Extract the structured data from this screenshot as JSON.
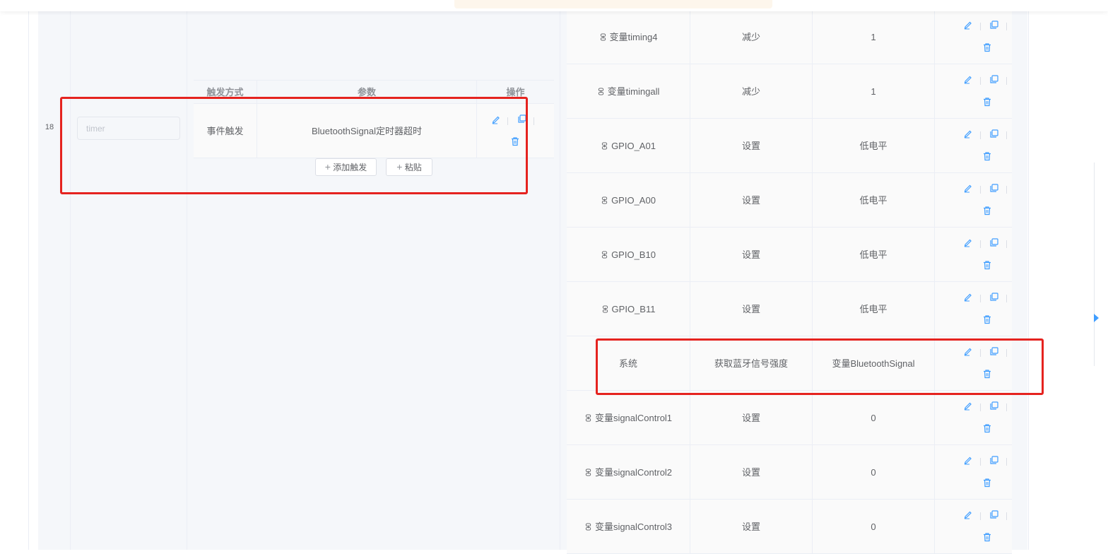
{
  "rule_row": {
    "index": "18",
    "name_placeholder": "timer"
  },
  "trigger_table": {
    "headers": [
      "触发方式",
      "参数",
      "操作"
    ],
    "row": {
      "mode": "事件触发",
      "param": "BluetoothSignal定时器超时"
    },
    "add_button": "添加触发",
    "paste_button": "粘贴"
  },
  "action_rows": [
    {
      "target": "变量timing4",
      "op": "减少",
      "value": "1",
      "linked": true
    },
    {
      "target": "变量timingall",
      "op": "减少",
      "value": "1",
      "linked": true
    },
    {
      "target": "GPIO_A01",
      "op": "设置",
      "value": "低电平",
      "linked": true
    },
    {
      "target": "GPIO_A00",
      "op": "设置",
      "value": "低电平",
      "linked": true
    },
    {
      "target": "GPIO_B10",
      "op": "设置",
      "value": "低电平",
      "linked": true
    },
    {
      "target": "GPIO_B11",
      "op": "设置",
      "value": "低电平",
      "linked": true
    },
    {
      "target": "系统",
      "op": "获取蓝牙信号强度",
      "value": "变量BluetoothSignal",
      "linked": false
    },
    {
      "target": "变量signalControl1",
      "op": "设置",
      "value": "0",
      "linked": true
    },
    {
      "target": "变量signalControl2",
      "op": "设置",
      "value": "0",
      "linked": true
    },
    {
      "target": "变量signalControl3",
      "op": "设置",
      "value": "0",
      "linked": true
    }
  ],
  "icons": {
    "edit": "edit-icon",
    "copy": "copy-icon",
    "delete": "delete-icon",
    "link": "link-icon"
  },
  "colors": {
    "accent": "#409eff",
    "highlight": "#e5231f"
  }
}
